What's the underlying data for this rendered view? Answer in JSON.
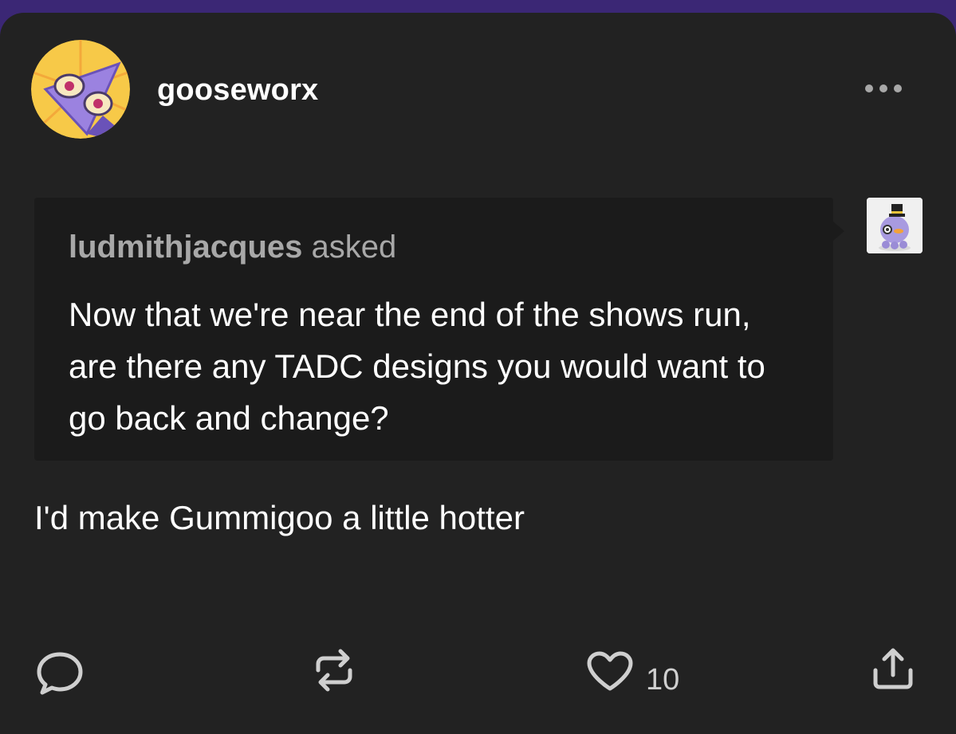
{
  "post": {
    "author": "gooseworx",
    "ask": {
      "asker": "ludmithjacques",
      "verb": "asked",
      "question": "Now that we're near the end of the shows run, are there any TADC designs you would want to go back and change?"
    },
    "answer": "I'd make Gummigoo a little hotter"
  },
  "actions": {
    "like_count": "10"
  },
  "icons": {
    "more": "more-icon",
    "reply": "reply-icon",
    "reblog": "reblog-icon",
    "like": "heart-icon",
    "share": "share-icon"
  },
  "colors": {
    "header_background": "#3b2775",
    "card_background": "#222222",
    "ask_background": "#1b1b1b",
    "text_primary": "#ffffff",
    "text_secondary": "#a8a8a8"
  }
}
